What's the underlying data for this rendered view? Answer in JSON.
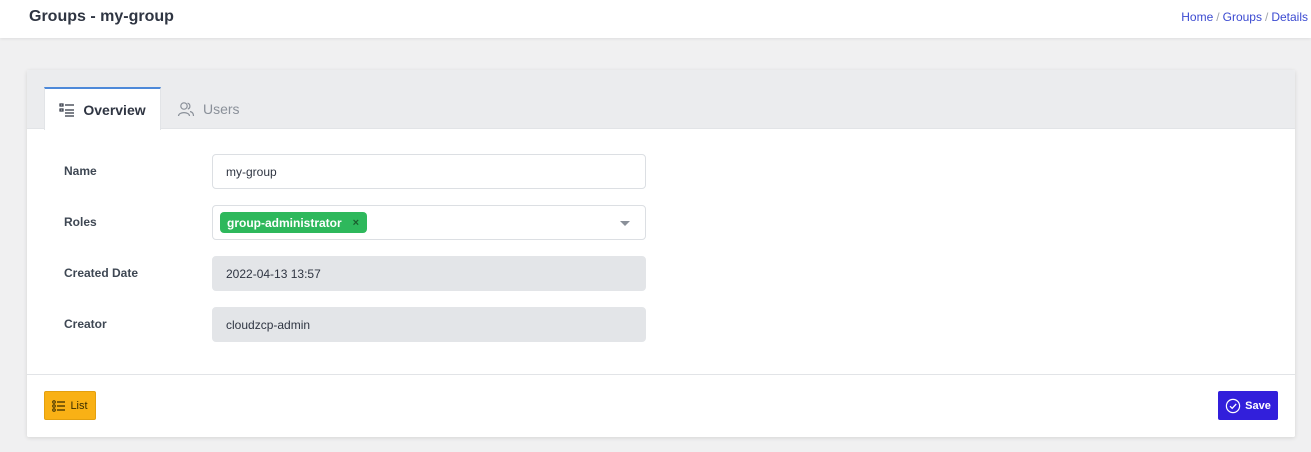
{
  "header": {
    "title": "Groups - my-group",
    "breadcrumb": [
      "Home",
      "Groups",
      "Details"
    ],
    "separator": "/"
  },
  "tabs": [
    {
      "label": "Overview",
      "icon": "list-details-icon",
      "active": true
    },
    {
      "label": "Users",
      "icon": "users-icon",
      "active": false
    }
  ],
  "form": {
    "name": {
      "label": "Name",
      "value": "my-group"
    },
    "roles": {
      "label": "Roles",
      "tags": [
        "group-administrator"
      ],
      "remove_glyph": "×"
    },
    "created_date": {
      "label": "Created Date",
      "value": "2022-04-13 13:57"
    },
    "creator": {
      "label": "Creator",
      "value": "cloudzcp-admin"
    }
  },
  "footer": {
    "list_label": "List",
    "save_label": "Save"
  },
  "colors": {
    "primary": "#321fdb",
    "warning": "#f9b115",
    "success": "#2eb85c",
    "tab_accent": "#4d89d9"
  }
}
